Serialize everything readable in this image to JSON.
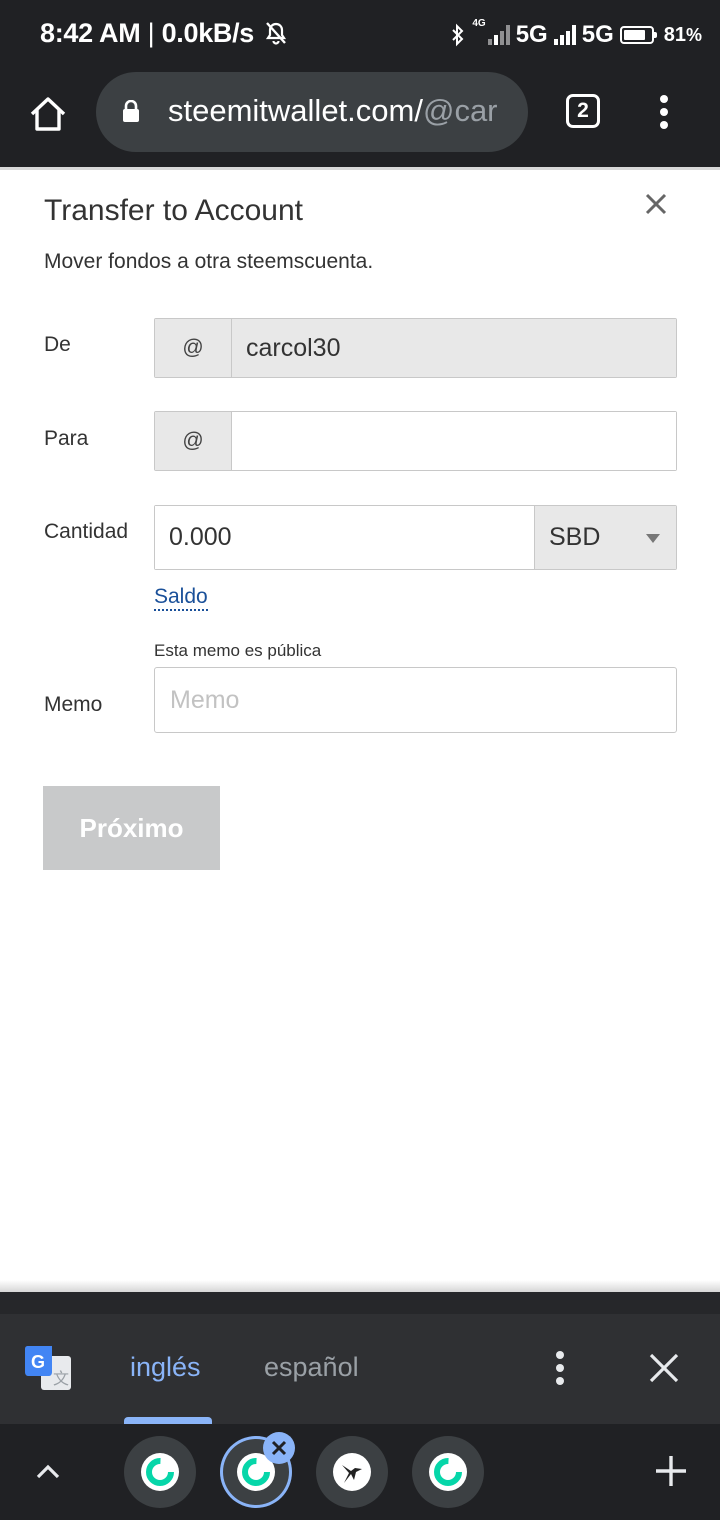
{
  "status_bar": {
    "time": "8:42 AM",
    "speed": "0.0kB/s",
    "network_1": "5G",
    "network_2": "5G",
    "small_label": "4G",
    "battery_percent": "81",
    "battery_level": 0.81
  },
  "browser": {
    "url_main": "steemitwallet.com/",
    "url_path": "@car",
    "tab_count": "2"
  },
  "dialog": {
    "title": "Transfer to Account",
    "subtitle": "Mover fondos a otra steemscuenta.",
    "from_label": "De",
    "from_prefix": "@",
    "from_value": "carcol30",
    "to_label": "Para",
    "to_prefix": "@",
    "to_value": "",
    "amount_label": "Cantidad",
    "amount_value": "0.000",
    "currency": "SBD",
    "balance_link": "Saldo",
    "memo_hint": "Esta memo es pública",
    "memo_label": "Memo",
    "memo_placeholder": "Memo",
    "next_button": "Próximo"
  },
  "translate_bar": {
    "source_lang": "inglés",
    "target_lang": "español"
  },
  "icons": [
    "home-icon",
    "lock-icon",
    "close-icon",
    "google-translate-icon",
    "more-vert-icon",
    "chevron-up-icon",
    "plus-icon"
  ],
  "colors": {
    "link": "#1a5099",
    "accent": "#8ab4f8",
    "steemit": "#06d6a9",
    "button_disabled": "#c8c9ca"
  }
}
